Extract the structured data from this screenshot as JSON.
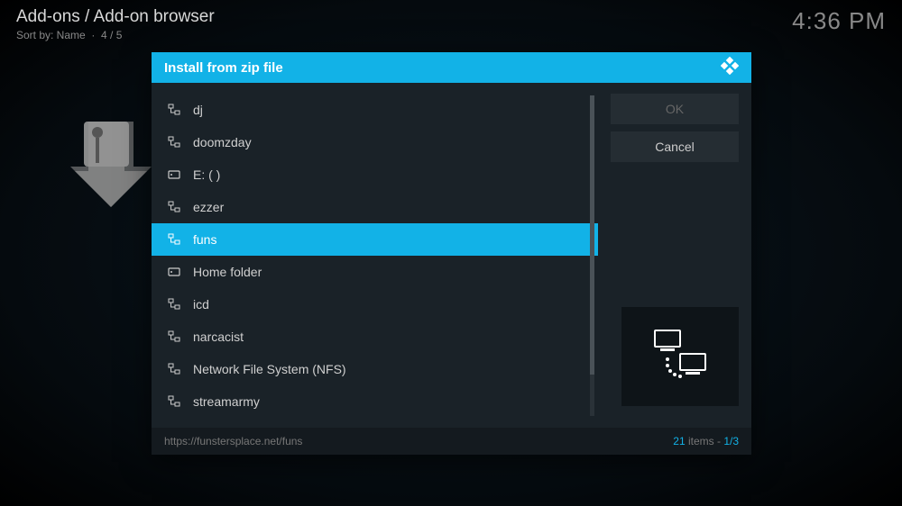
{
  "header": {
    "breadcrumb": "Add-ons / Add-on browser",
    "sort_label": "Sort by: Name",
    "sort_index": "4 / 5"
  },
  "clock": "4:36 PM",
  "dialog": {
    "title": "Install from zip file",
    "items": [
      {
        "label": "dj",
        "icon": "network",
        "selected": false
      },
      {
        "label": "doomzday",
        "icon": "network",
        "selected": false
      },
      {
        "label": "E: ( )",
        "icon": "drive",
        "selected": false
      },
      {
        "label": "ezzer",
        "icon": "network",
        "selected": false
      },
      {
        "label": "funs",
        "icon": "network",
        "selected": true
      },
      {
        "label": "Home folder",
        "icon": "drive",
        "selected": false
      },
      {
        "label": "icd",
        "icon": "network",
        "selected": false
      },
      {
        "label": "narcacist",
        "icon": "network",
        "selected": false
      },
      {
        "label": "Network File System (NFS)",
        "icon": "network",
        "selected": false
      },
      {
        "label": "streamarmy",
        "icon": "network",
        "selected": false
      }
    ],
    "buttons": {
      "ok": "OK",
      "cancel": "Cancel"
    },
    "footer": {
      "path": "https://funstersplace.net/funs",
      "count": "21",
      "count_label": "items",
      "page": "1/3"
    }
  }
}
